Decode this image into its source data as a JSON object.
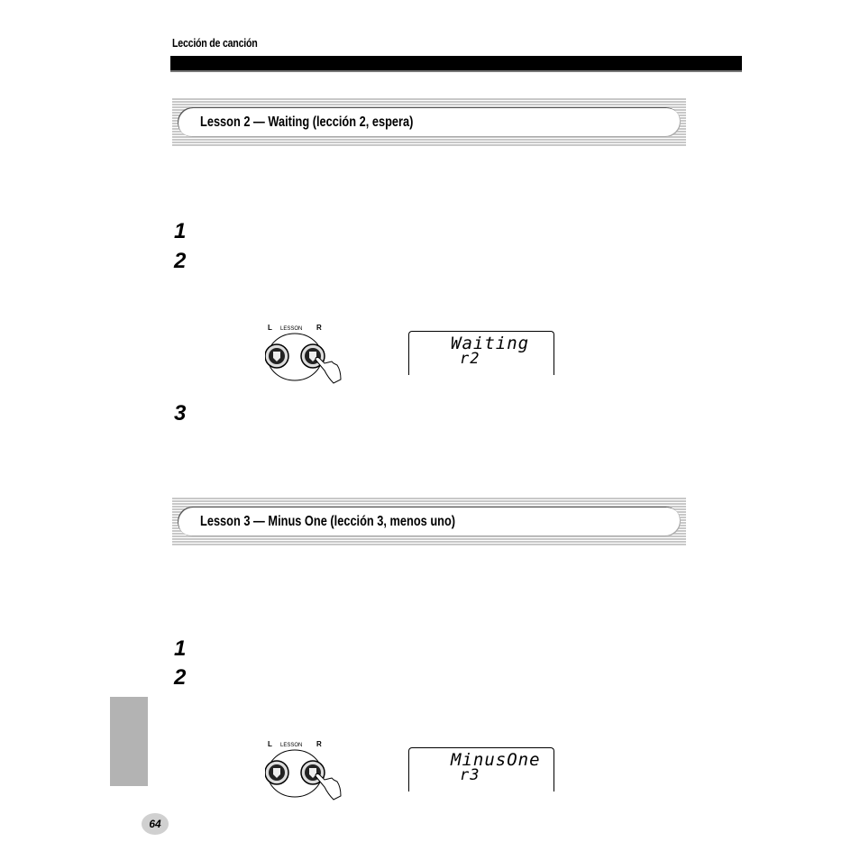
{
  "header": {
    "running_title": "Lección de canción"
  },
  "sections": [
    {
      "title": "Lesson 2 — Waiting (lección 2, espera)",
      "steps": [
        "1",
        "2",
        "3"
      ],
      "panel": {
        "left_label": "L",
        "center_label": "LESSON",
        "right_label": "R"
      },
      "display": {
        "line1": "Waiting",
        "line2": "r2"
      }
    },
    {
      "title": "Lesson 3 — Minus One (lección 3, menos uno)",
      "steps": [
        "1",
        "2"
      ],
      "panel": {
        "left_label": "L",
        "center_label": "LESSON",
        "right_label": "R"
      },
      "display": {
        "line1": "MinusOne",
        "line2": "r3"
      }
    }
  ],
  "footer": {
    "page_number": "64"
  },
  "colors": {
    "bar": "#000000",
    "tab": "#b3b3b3",
    "badge": "#d0d0d0"
  }
}
